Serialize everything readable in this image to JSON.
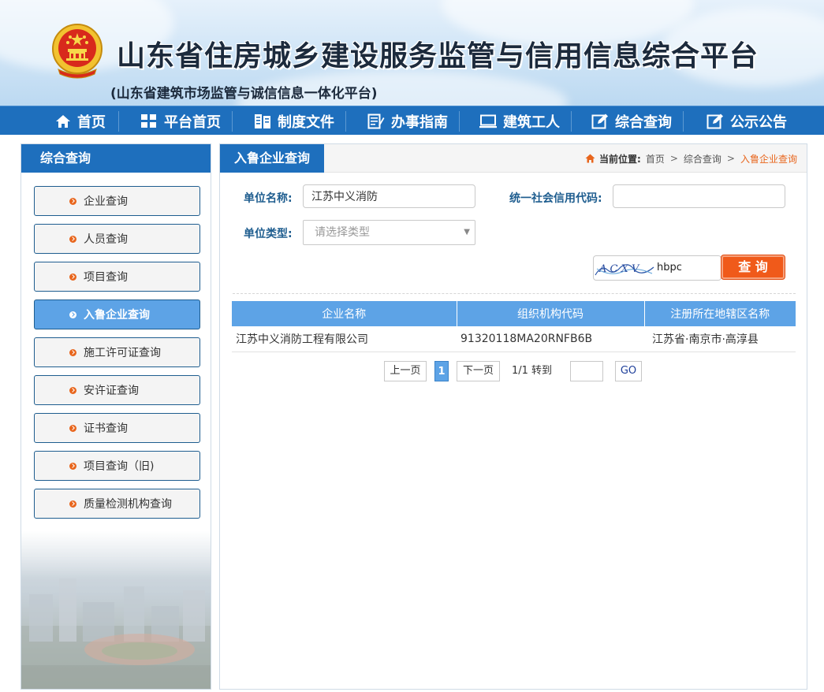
{
  "header": {
    "title": "山东省住房城乡建设服务监管与信用信息综合平台",
    "subtitle": "(山东省建筑市场监管与诚信信息一体化平台)",
    "emblem_icon": "national-emblem-icon"
  },
  "nav": {
    "items": [
      {
        "label": "首页",
        "icon": "home-icon"
      },
      {
        "label": "平台首页",
        "icon": "grid-icon"
      },
      {
        "label": "制度文件",
        "icon": "document-icon"
      },
      {
        "label": "办事指南",
        "icon": "guide-icon"
      },
      {
        "label": "建筑工人",
        "icon": "monitor-icon"
      },
      {
        "label": "综合查询",
        "icon": "edit-icon"
      },
      {
        "label": "公示公告",
        "icon": "notice-icon"
      }
    ]
  },
  "sidebar": {
    "title": "综合查询",
    "items": [
      {
        "label": "企业查询",
        "active": false
      },
      {
        "label": "人员查询",
        "active": false
      },
      {
        "label": "项目查询",
        "active": false
      },
      {
        "label": "入鲁企业查询",
        "active": true
      },
      {
        "label": "施工许可证查询",
        "active": false
      },
      {
        "label": "安许证查询",
        "active": false
      },
      {
        "label": "证书查询",
        "active": false
      },
      {
        "label": "项目查询（旧)",
        "active": false
      },
      {
        "label": "质量检测机构查询",
        "active": false
      }
    ]
  },
  "main": {
    "tab_title": "入鲁企业查询",
    "breadcrumb": {
      "label": "当前位置:",
      "items": [
        "首页",
        "综合查询",
        "入鲁企业查询"
      ],
      "separator": ">"
    },
    "form": {
      "unit_name_label": "单位名称:",
      "unit_name_value": "江苏中义消防",
      "credit_code_label": "统一社会信用代码:",
      "credit_code_value": "",
      "unit_type_label": "单位类型:",
      "unit_type_placeholder": "请选择类型",
      "captcha_image_text": "A C X V",
      "captcha_value": "hbpc",
      "query_button": "查 询"
    },
    "table": {
      "headers": [
        "企业名称",
        "组织机构代码",
        "注册所在地辖区名称"
      ],
      "rows": [
        [
          "江苏中义消防工程有限公司",
          "91320118MA20RNFB6B",
          "江苏省·南京市·高淳县"
        ]
      ]
    },
    "pager": {
      "prev": "上一页",
      "current": "1",
      "next": "下一页",
      "info": "1/1 转到",
      "go": "GO"
    }
  },
  "colors": {
    "primary": "#1e6fbd",
    "light_blue": "#5da3e6",
    "accent_orange": "#f05a1a",
    "label_blue": "#1e5d8f"
  }
}
